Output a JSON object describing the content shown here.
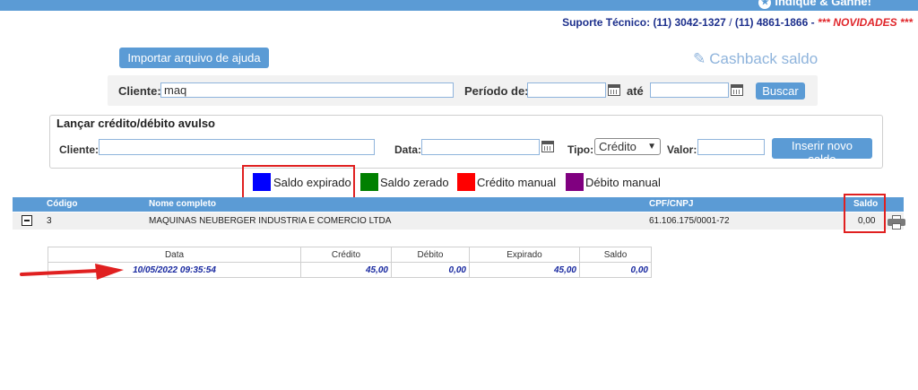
{
  "header": {
    "link_label": "Indiqué & Ganhe!",
    "support_label": "Suporte Técnico:",
    "phone1": "(11) 3042-1327",
    "separator": "/",
    "phone2": "(11) 4861-1866",
    "news": "*** NOVIDADES ***"
  },
  "toolbar": {
    "help_button": "Importar arquivo de ajuda",
    "cashback_link": "Cashback saldo"
  },
  "search": {
    "cliente_label": "Cliente:",
    "cliente_value": "maq",
    "periodo_label": "Período de:",
    "ate_label": "até",
    "buscar_label": "Buscar"
  },
  "manual": {
    "title": "Lançar crédito/débito avulso",
    "cliente_label": "Cliente:",
    "data_label": "Data:",
    "tipo_label": "Tipo:",
    "tipo_value": "Crédito",
    "valor_label": "Valor:",
    "insert_button": "Inserir novo saldo"
  },
  "legend": [
    {
      "label": "Saldo expirado",
      "color": "#0000ff"
    },
    {
      "label": "Saldo zerado",
      "color": "#008000"
    },
    {
      "label": "Crédito manual",
      "color": "#ff0000"
    },
    {
      "label": "Débito manual",
      "color": "#800080"
    }
  ],
  "main_table": {
    "headers": {
      "codigo": "Código",
      "nome": "Nome completo",
      "cpf": "CPF/CNPJ",
      "saldo": "Saldo"
    },
    "row": {
      "codigo": "3",
      "nome": "MAQUINAS NEUBERGER INDUSTRIA E COMERCIO LTDA",
      "cpf": "61.106.175/0001-72",
      "saldo": "0,00"
    }
  },
  "detail_table": {
    "headers": [
      "Data",
      "Crédito",
      "Débito",
      "Expirado",
      "Saldo"
    ],
    "row": [
      "10/05/2022 09:35:54",
      "45,00",
      "0,00",
      "45,00",
      "0,00"
    ]
  },
  "colors": {
    "accent": "#5b9bd5",
    "highlight": "#e02020",
    "detail_text": "#1a2aa0"
  }
}
